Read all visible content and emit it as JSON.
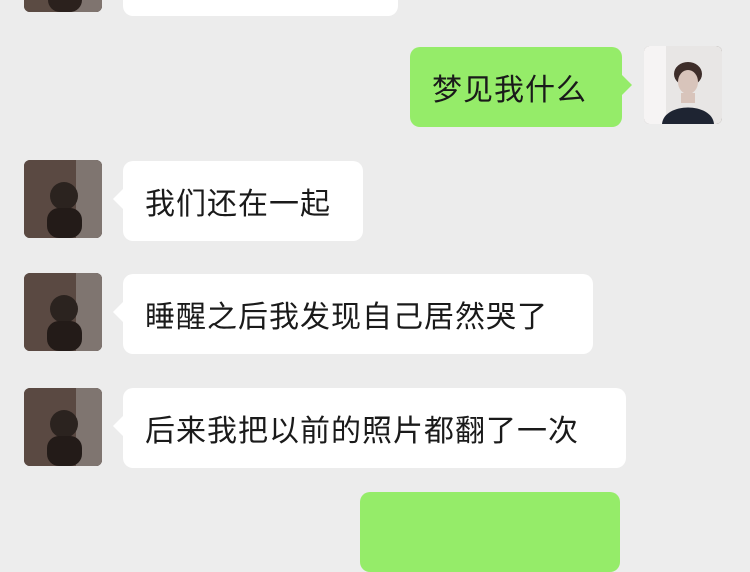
{
  "messages": [
    {
      "side": "incoming",
      "text": ""
    },
    {
      "side": "outgoing",
      "text": "梦见我什么"
    },
    {
      "side": "incoming",
      "text": "我们还在一起"
    },
    {
      "side": "incoming",
      "text": "睡醒之后我发现自己居然哭了"
    },
    {
      "side": "incoming",
      "text": "后来我把以前的照片都翻了一次"
    },
    {
      "side": "outgoing",
      "text": ""
    }
  ],
  "colors": {
    "background": "#ececec",
    "incoming_bubble": "#ffffff",
    "outgoing_bubble": "#95ec69",
    "text": "#1a1a1a"
  },
  "icons": {
    "avatar_left": "contact-avatar-photo",
    "avatar_right": "self-avatar-photo"
  }
}
